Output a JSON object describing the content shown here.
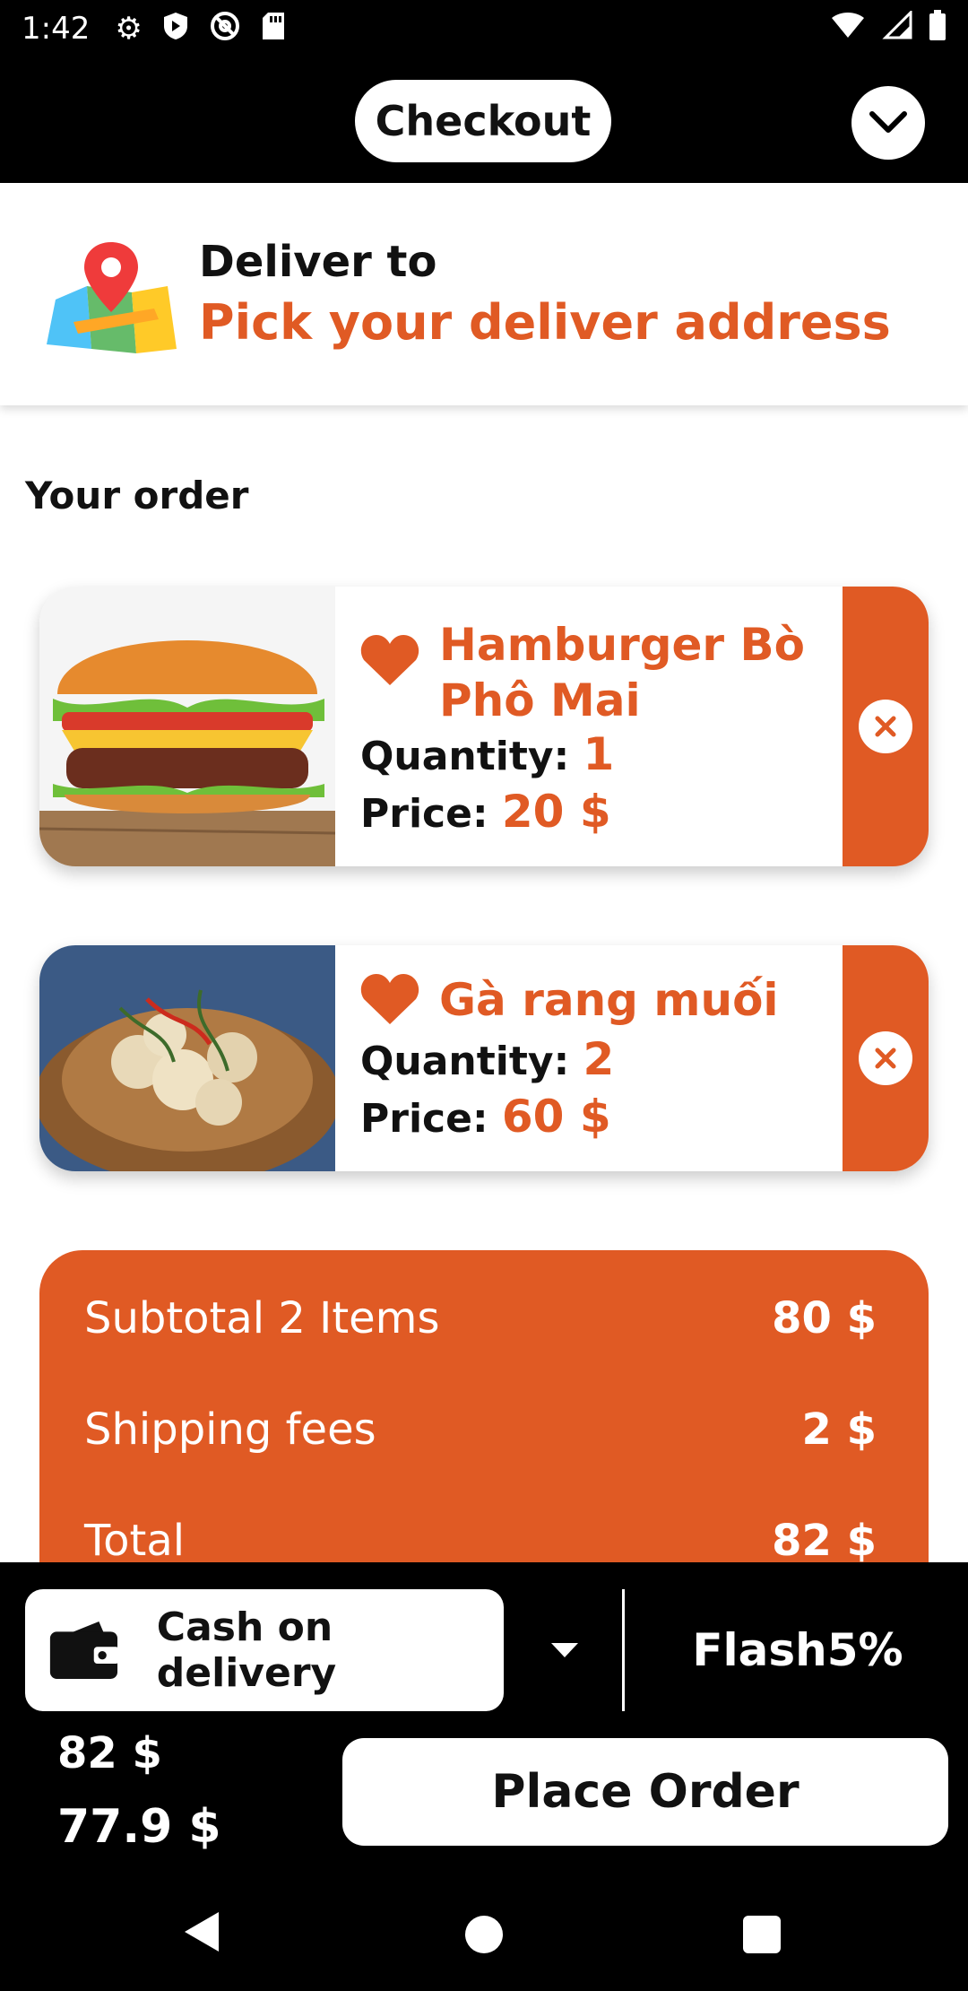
{
  "status_bar": {
    "time": "1:42",
    "left_icons": [
      "gear-icon",
      "shield-icon",
      "at-sign-icon",
      "sd-card-icon"
    ],
    "right_icons": [
      "wifi-icon",
      "signal-icon",
      "battery-icon"
    ]
  },
  "header": {
    "title": "Checkout",
    "collapse_icon": "chevron-down-icon"
  },
  "deliver": {
    "title": "Deliver to",
    "address_placeholder": "Pick your deliver address",
    "icon": "map-pin-icon"
  },
  "order": {
    "heading": "Your order",
    "quantity_label": "Quantity:",
    "price_label": "Price:",
    "items": [
      {
        "name": "Hamburger Bò Phô Mai",
        "quantity": "1",
        "price": "20 $",
        "favorite_icon": "heart-icon",
        "remove_icon": "close-icon"
      },
      {
        "name": "Gà rang muối",
        "quantity": "2",
        "price": "60 $",
        "favorite_icon": "heart-icon",
        "remove_icon": "close-icon"
      }
    ]
  },
  "summary": {
    "subtotal_label": "Subtotal 2 Items",
    "subtotal_value": "80 $",
    "shipping_label": "Shipping fees",
    "shipping_value": "2 $",
    "total_label": "Total",
    "total_value": "82 $"
  },
  "payment": {
    "method": "Cash on delivery",
    "wallet_icon": "wallet-icon",
    "dropdown_icon": "caret-down-icon",
    "voucher": "Flash5%",
    "original_price": "82 $",
    "discounted_price": "77.9 $",
    "place_order_label": "Place Order"
  },
  "colors": {
    "accent": "#e05a24",
    "background_dark": "#000000",
    "surface": "#ffffff"
  }
}
